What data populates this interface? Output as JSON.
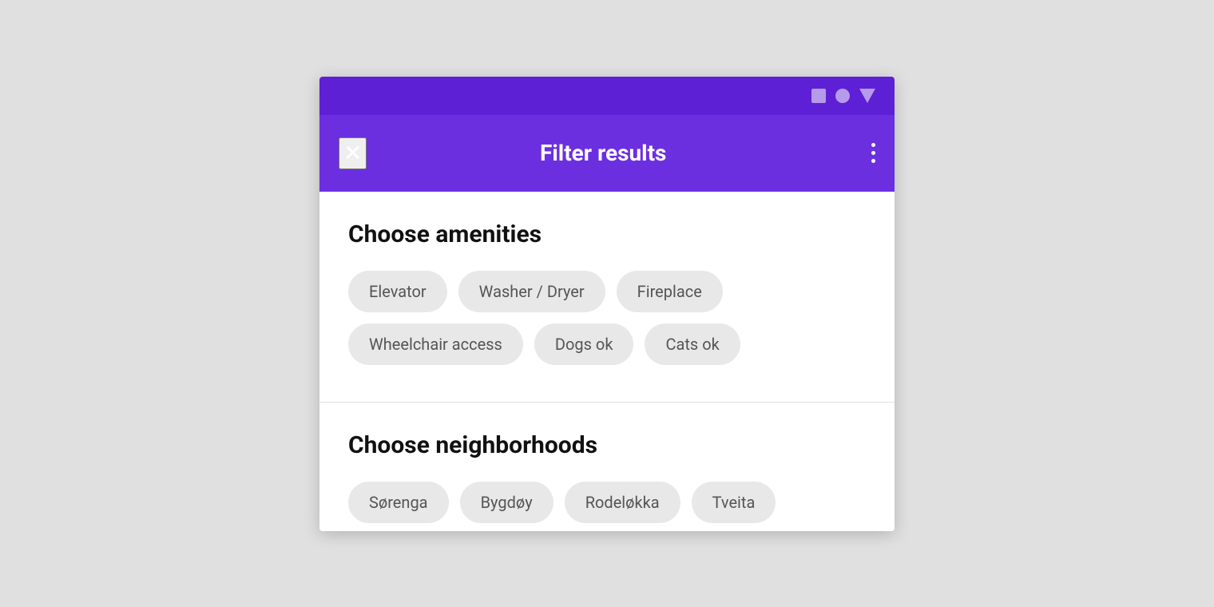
{
  "statusBar": {
    "icons": [
      "square",
      "circle",
      "triangle"
    ]
  },
  "appBar": {
    "closeLabel": "✕",
    "title": "Filter results",
    "moreLabel": "⋮"
  },
  "amenities": {
    "sectionTitle": "Choose amenities",
    "chips": [
      {
        "id": "elevator",
        "label": "Elevator"
      },
      {
        "id": "washer-dryer",
        "label": "Washer / Dryer"
      },
      {
        "id": "fireplace",
        "label": "Fireplace"
      },
      {
        "id": "wheelchair-access",
        "label": "Wheelchair access"
      },
      {
        "id": "dogs-ok",
        "label": "Dogs ok"
      },
      {
        "id": "cats-ok",
        "label": "Cats ok"
      }
    ]
  },
  "neighborhoods": {
    "sectionTitle": "Choose neighborhoods",
    "chips": [
      {
        "id": "sorenga",
        "label": "Sørenga"
      },
      {
        "id": "bygdoy",
        "label": "Bygdøy"
      },
      {
        "id": "rodeloekka",
        "label": "Rodeløkka"
      },
      {
        "id": "tveita",
        "label": "Tveita"
      }
    ]
  }
}
